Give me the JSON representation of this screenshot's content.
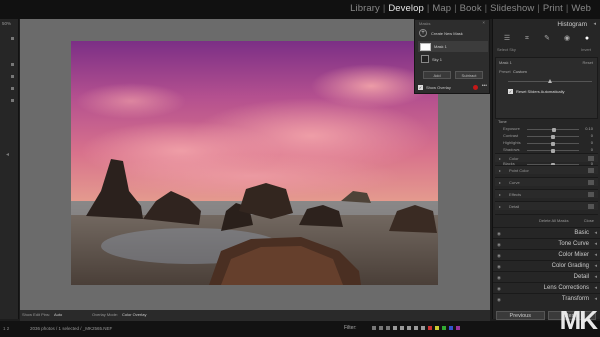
{
  "topbar": {
    "modules": [
      "Library",
      "Develop",
      "Map",
      "Book",
      "Slideshow",
      "Print",
      "Web"
    ],
    "active_module": "Develop"
  },
  "left_rail": {
    "zoom": "50%"
  },
  "masks_panel": {
    "title": "Masks",
    "create_label": "Create New Mask",
    "mask1_label": "Mask 1",
    "sky1_label": "Sky 1",
    "add_label": "Add",
    "subtract_label": "Subtract",
    "show_overlay_label": "Show Overlay",
    "overlay_color": "#c41818"
  },
  "right_panel": {
    "histogram_label": "Histogram",
    "select_label": "Select Sky",
    "invert_label": "Invert",
    "mask_name": "Mask 1",
    "reset_label": "Reset",
    "preset_label": "Preset",
    "preset_value": "Custom",
    "amount_value": 0.5,
    "reset_sliders_label": "Reset Sliders Automatically",
    "tone_header": "Tone",
    "tone_sliders": [
      {
        "label": "Exposure",
        "value": "0.10",
        "pos": 0.52
      },
      {
        "label": "Contrast",
        "value": "0",
        "pos": 0.5
      },
      {
        "label": "Highlights",
        "value": "0",
        "pos": 0.5
      },
      {
        "label": "Shadows",
        "value": "0",
        "pos": 0.5
      },
      {
        "label": "Whites",
        "value": "0",
        "pos": 0.5
      },
      {
        "label": "Blacks",
        "value": "0",
        "pos": 0.5
      }
    ],
    "collapsed_sections": [
      "Color",
      "Point Color",
      "Curve",
      "Effects",
      "Detail"
    ],
    "delete_all_label": "Delete All Masks",
    "close_label": "Close",
    "panels": [
      "Basic",
      "Tone Curve",
      "Color Mixer",
      "Color Grading",
      "Detail",
      "Lens Corrections",
      "Transform"
    ],
    "previous_label": "Previous",
    "reset_button_label": "Reset"
  },
  "bottom_bar": {
    "show_edit_pins_label": "Show Edit Pins:",
    "pins_value": "Auto",
    "overlay_mode_label": "Overlay Mode:",
    "overlay_mode_value": "Color Overlay"
  },
  "filmstrip": {
    "left_label": "1  2",
    "path": "2036 photos / 1 selected / _MK2565.NEF",
    "filter_label": "Filter:"
  },
  "watermark": "MK"
}
